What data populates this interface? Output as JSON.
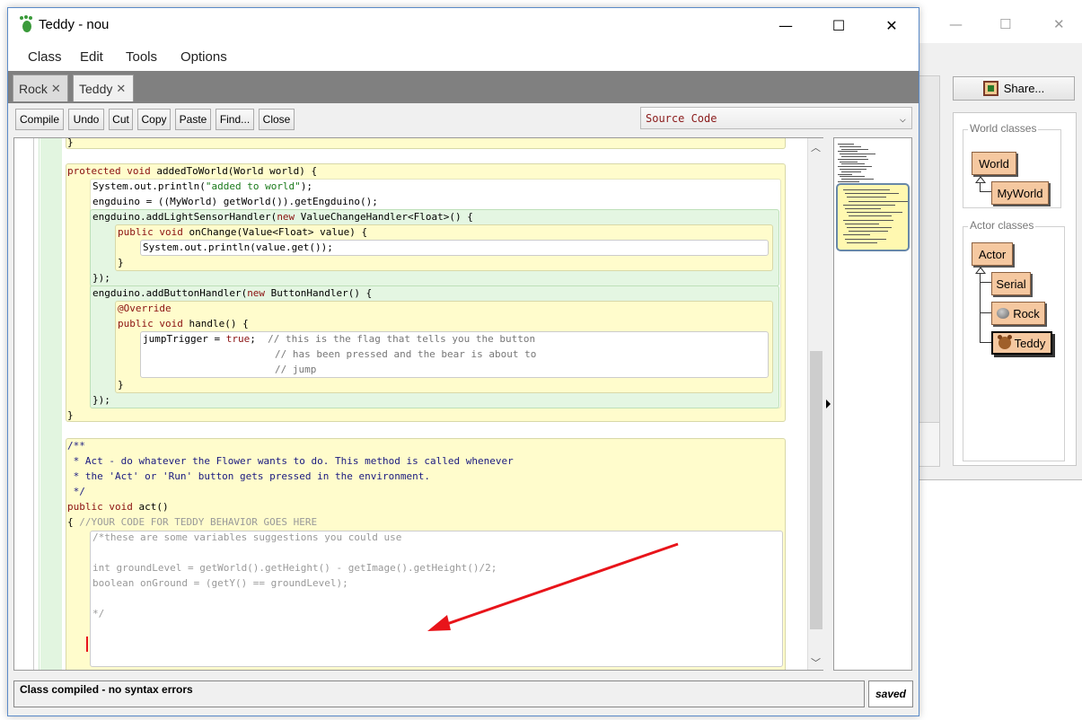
{
  "background_window": {
    "share_label": "Share...",
    "world_group_label": "World classes",
    "actor_group_label": "Actor classes",
    "classes": {
      "world": "World",
      "myworld": "MyWorld",
      "actor": "Actor",
      "serial": "Serial",
      "rock": "Rock",
      "teddy": "Teddy"
    }
  },
  "window": {
    "title": "Teddy - nou"
  },
  "menu": [
    "Class",
    "Edit",
    "Tools",
    "Options"
  ],
  "tabs": [
    {
      "label": "Rock",
      "close": "✕"
    },
    {
      "label": "Teddy",
      "close": "✕"
    }
  ],
  "toolbar": {
    "compile": "Compile",
    "undo": "Undo",
    "cut": "Cut",
    "copy": "Copy",
    "paste": "Paste",
    "find": "Find...",
    "close": "Close",
    "view_selected": "Source Code"
  },
  "code": {
    "l1": "}",
    "l2_kw": "protected void",
    "l2_rest": " addedToWorld(World world) {",
    "l3_a": "System.out.println(",
    "l3_s": "\"added to world\"",
    "l3_b": ");",
    "l4": "engduino = ((MyWorld) getWorld()).getEngduino();",
    "l5_a": "engduino.addLightSensorHandler(",
    "l5_kw": "new",
    "l5_b": " ValueChangeHandler<Float>() {",
    "l6_kw": "public void",
    "l6_rest": " onChange(Value<Float> value) {",
    "l7": "System.out.println(value.get());",
    "l8": "}",
    "l9": "});",
    "l10_a": "engduino.addButtonHandler(",
    "l10_kw": "new",
    "l10_b": " ButtonHandler() {",
    "l11": "@Override",
    "l12_kw": "public void",
    "l12_rest": " handle() {",
    "l13_a": "jumpTrigger = ",
    "l13_kw": "true",
    "l13_b": ";  ",
    "l13_c": "// this is the flag that tells you the button",
    "l14": "// has been pressed and the bear is about to",
    "l15": "// jump",
    "l16": "}",
    "l17": "});",
    "l18": "}",
    "l19": "/**",
    "l20": " * Act - do whatever the Flower wants to do. This method is called whenever",
    "l21": " * the 'Act' or 'Run' button gets pressed in the environment.",
    "l22": " */",
    "l23_kw": "public void",
    "l23_rest": " act()",
    "l24_a": "{ ",
    "l24_c": "//YOUR CODE FOR TEDDY BEHAVIOR GOES HERE",
    "l25": "/*these are some variables suggestions you could use",
    "l26": "int groundLevel = getWorld().getHeight() - getImage().getHeight()/2;",
    "l27": "boolean onGround = (getY() == groundLevel);",
    "l28": "*/"
  },
  "status": {
    "message": "Class compiled - no syntax errors",
    "saved": "saved"
  },
  "colors": {
    "accent_border": "#5a8ac8",
    "annotation_arrow": "#e8141a",
    "class_box": "#f5c8a0"
  },
  "icons": {
    "app": "greenfoot-footprint-icon",
    "tab_close": "close-icon",
    "dropdown": "chevron-down-icon"
  }
}
